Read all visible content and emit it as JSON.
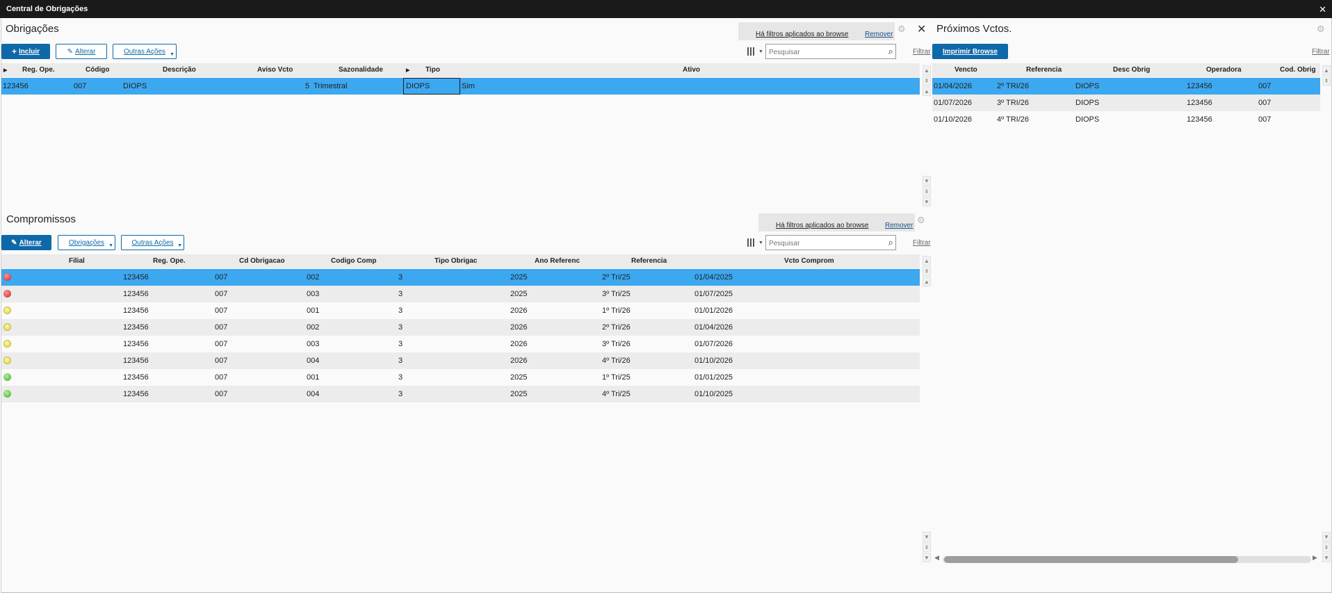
{
  "window": {
    "title": "Central de Obrigações"
  },
  "obrigacoes": {
    "title": "Obrigações",
    "buttons": {
      "incluir": "Incluir",
      "alterar": "Alterar",
      "outras": "Outras Ações"
    },
    "filter_msg": "Há filtros aplicados ao browse",
    "remover": "Remover",
    "search_placeholder": "Pesquisar",
    "filtrar": "Filtrar",
    "columns": [
      "Reg. Ope.",
      "Código",
      "Descrição",
      "Aviso Vcto",
      "Sazonalidade",
      "Tipo",
      "Ativo"
    ],
    "rows": [
      {
        "reg": "123456",
        "codigo": "007",
        "descricao": "DIOPS",
        "aviso": "5",
        "sazonalidade": "Trimestral",
        "tipo": "DIOPS",
        "ativo": "Sim"
      }
    ]
  },
  "compromissos": {
    "title": "Compromissos",
    "buttons": {
      "alterar": "Alterar",
      "obrigacoes": "Obrigações",
      "outras": "Outras Ações"
    },
    "filter_msg": "Há filtros aplicados ao browse",
    "remover": "Remover",
    "search_placeholder": "Pesquisar",
    "filtrar": "Filtrar",
    "columns": [
      "Filial",
      "Reg. Ope.",
      "Cd Obrigacao",
      "Codigo Comp",
      "Tipo Obrigac",
      "Ano Referenc",
      "Referencia",
      "Vcto Comprom"
    ],
    "rows": [
      {
        "status": "red",
        "reg": "123456",
        "cd": "007",
        "comp": "002",
        "tipo": "3",
        "ano": "2025",
        "ref": "2º Tri/25",
        "vcto": "01/04/2025"
      },
      {
        "status": "red",
        "reg": "123456",
        "cd": "007",
        "comp": "003",
        "tipo": "3",
        "ano": "2025",
        "ref": "3º Tri/25",
        "vcto": "01/07/2025"
      },
      {
        "status": "yellow",
        "reg": "123456",
        "cd": "007",
        "comp": "001",
        "tipo": "3",
        "ano": "2026",
        "ref": "1º Tri/26",
        "vcto": "01/01/2026"
      },
      {
        "status": "yellow",
        "reg": "123456",
        "cd": "007",
        "comp": "002",
        "tipo": "3",
        "ano": "2026",
        "ref": "2º Tri/26",
        "vcto": "01/04/2026"
      },
      {
        "status": "yellow",
        "reg": "123456",
        "cd": "007",
        "comp": "003",
        "tipo": "3",
        "ano": "2026",
        "ref": "3º Tri/26",
        "vcto": "01/07/2026"
      },
      {
        "status": "yellow",
        "reg": "123456",
        "cd": "007",
        "comp": "004",
        "tipo": "3",
        "ano": "2026",
        "ref": "4º Tri/26",
        "vcto": "01/10/2026"
      },
      {
        "status": "green",
        "reg": "123456",
        "cd": "007",
        "comp": "001",
        "tipo": "3",
        "ano": "2025",
        "ref": "1º Tri/25",
        "vcto": "01/01/2025"
      },
      {
        "status": "green",
        "reg": "123456",
        "cd": "007",
        "comp": "004",
        "tipo": "3",
        "ano": "2025",
        "ref": "4º Tri/25",
        "vcto": "01/10/2025"
      }
    ]
  },
  "proximos": {
    "title": "Próximos Vctos.",
    "button": "Imprimir Browse",
    "filtrar": "Filtrar",
    "columns": [
      "Vencto",
      "Referencia",
      "Desc Obrig",
      "Operadora",
      "Cod. Obrig"
    ],
    "rows": [
      {
        "vencto": "01/04/2026",
        "ref": "2º TRI/26",
        "desc": "DIOPS",
        "oper": "123456",
        "cod": "007"
      },
      {
        "vencto": "01/07/2026",
        "ref": "3º TRI/26",
        "desc": "DIOPS",
        "oper": "123456",
        "cod": "007"
      },
      {
        "vencto": "01/10/2026",
        "ref": "4º TRI/26",
        "desc": "DIOPS",
        "oper": "123456",
        "cod": "007"
      }
    ]
  },
  "colors": {
    "accent": "#0e69a8",
    "selected_row": "#3ca8f0",
    "titlebar": "#1a1a1a"
  }
}
